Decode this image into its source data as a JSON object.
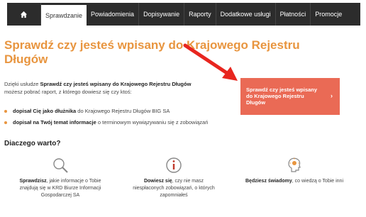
{
  "nav": {
    "items": [
      {
        "label": "Sprawdzanie"
      },
      {
        "label": "Powiadomienia"
      },
      {
        "label": "Dopisywanie"
      },
      {
        "label": "Raporty"
      },
      {
        "label": "Dodatkowe usługi"
      },
      {
        "label": "Płatności"
      },
      {
        "label": "Promocje"
      }
    ]
  },
  "main": {
    "title": "Sprawdź czy jesteś wpisany do Krajowego Rejestru Długów",
    "intro": {
      "prefix": "Dzięki usłudze ",
      "bold": "Sprawdź czy jesteś wpisany do Krajowego Rejestru Długów",
      "suffix": " możesz pobrać raport, z którego dowiesz się czy ktoś:"
    },
    "bullets": [
      {
        "bold": "dopisał Cię jako dłużnika",
        "text": " do Krajowego Rejestru Długów BIG SA"
      },
      {
        "bold": "dopisał na Twój temat informacje",
        "text": " o terminowym wywiązywaniu się z zobowiązań"
      }
    ],
    "cta_label": "Sprawdź czy jesteś wpisany do Krajowego Rejestru Długów",
    "cta_chevron": "›",
    "why_heading": "Diaczego warto?",
    "features": [
      {
        "bold": "Sprawdzisz",
        "text": ", jakie informacje o Tobie znajdują się w KRD Biurze Informacji Gospodarczej SA"
      },
      {
        "bold": "Dowiesz się",
        "text": ", czy nie masz niespłaconych zobowiązań, o których zapomniałeś"
      },
      {
        "bold": "Będziesz świadomy",
        "text": ", co wiedzą o Tobie inni"
      }
    ]
  },
  "colors": {
    "accent": "#e8953f",
    "cta": "#ea6a55",
    "nav": "#2c2c2c",
    "arrow": "#e8261f"
  },
  "icons": [
    "home-icon",
    "magnifier-icon",
    "info-icon",
    "lightbulb-head-icon",
    "arrow-annotation"
  ]
}
